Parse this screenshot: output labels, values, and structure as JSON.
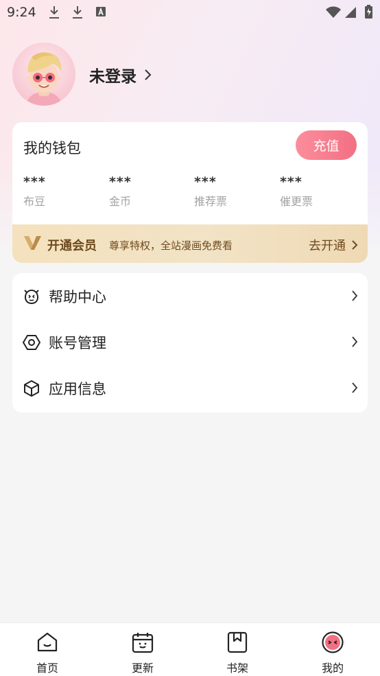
{
  "status_bar": {
    "time": "9:24",
    "icons": [
      "download-icon",
      "download-icon",
      "a-icon",
      "wifi-icon",
      "signal-icon",
      "battery-icon"
    ]
  },
  "profile": {
    "login_text": "未登录"
  },
  "wallet": {
    "title": "我的钱包",
    "recharge_label": "充值",
    "stats": [
      {
        "value": "***",
        "label": "布豆"
      },
      {
        "value": "***",
        "label": "金币"
      },
      {
        "value": "***",
        "label": "推荐票"
      },
      {
        "value": "***",
        "label": "催更票"
      }
    ]
  },
  "vip": {
    "title": "开通会员",
    "desc": "尊享特权，全站漫画免费看",
    "action": "去开通"
  },
  "menu": [
    {
      "label": "帮助中心",
      "icon": "help-face-icon"
    },
    {
      "label": "账号管理",
      "icon": "hexagon-gear-icon"
    },
    {
      "label": "应用信息",
      "icon": "box-icon"
    }
  ],
  "bottom_nav": [
    {
      "label": "首页",
      "icon": "home-icon"
    },
    {
      "label": "更新",
      "icon": "calendar-icon"
    },
    {
      "label": "书架",
      "icon": "bookshelf-icon"
    },
    {
      "label": "我的",
      "icon": "profile-face-icon",
      "active": true
    }
  ],
  "colors": {
    "accent": "#f36f83",
    "vip_text": "#6e4a1e",
    "vip_bg": "#f4e1bd"
  }
}
